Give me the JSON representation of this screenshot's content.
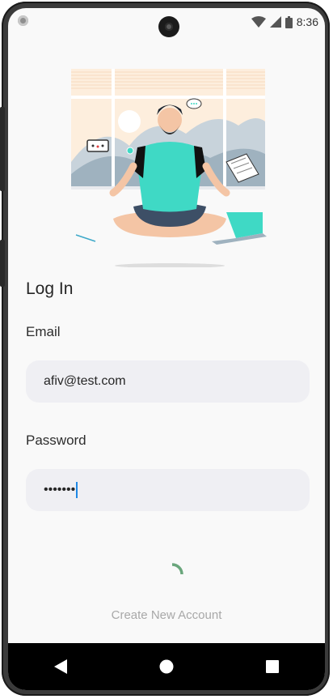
{
  "status_bar": {
    "time": "8:36",
    "icons": [
      "wifi-icon",
      "signal-icon",
      "battery-icon"
    ]
  },
  "login": {
    "title": "Log In",
    "email_label": "Email",
    "email_value": "afiv@test.com",
    "password_label": "Password",
    "password_value": "•••••••",
    "create_account_label": "Create New Account"
  },
  "nav_bar": {
    "icons": [
      "back-icon",
      "home-icon",
      "recents-icon"
    ]
  },
  "colors": {
    "accent": "#3fd9c5",
    "spinner": "#6aa67c",
    "caret": "#1e88e5"
  }
}
